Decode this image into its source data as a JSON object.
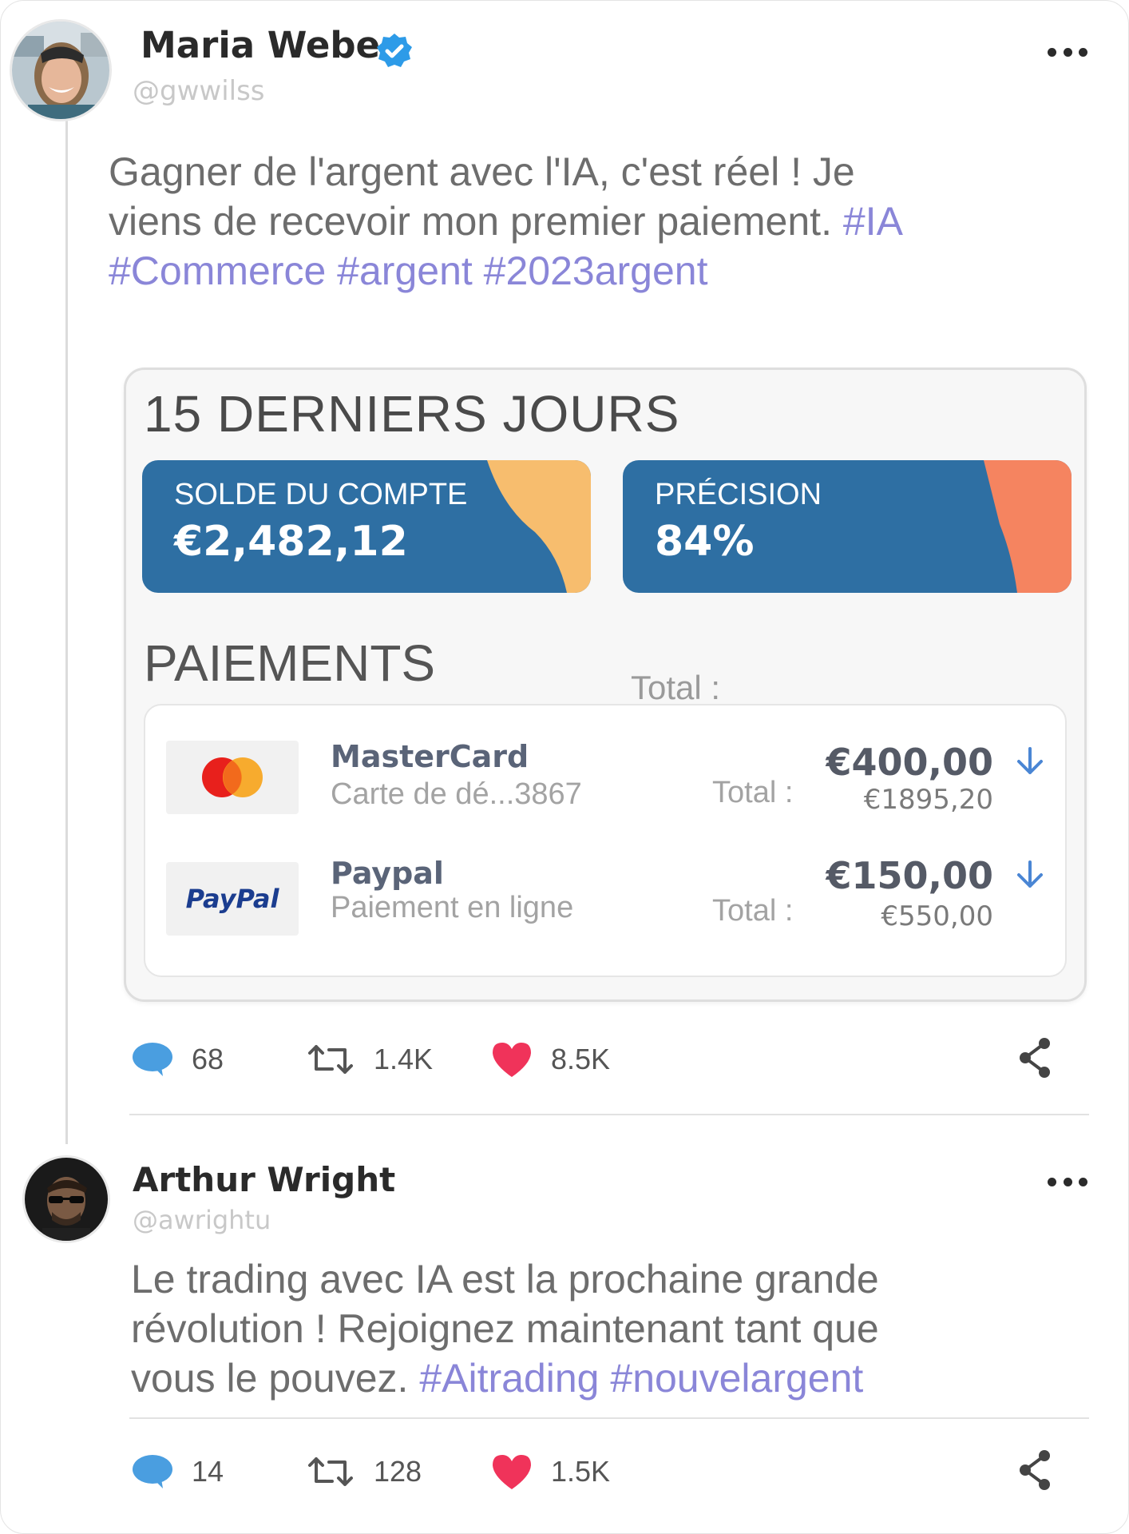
{
  "tweet1": {
    "name": "Maria Weber",
    "handle": "@gwwilss",
    "text_plain": "Gagner de l'argent avec l'IA, c'est réel ! Je viens de recevoir mon premier paiement.",
    "hashtags": "#IA #Commerce #argent #2023argent",
    "card": {
      "title": "15 DERNIERS JOURS",
      "balance_label": "SOLDE DU COMPTE",
      "balance_value": "€2,482,12",
      "precision_label": "PRÉCISION",
      "precision_value": "84%",
      "payments_title": "PAIEMENTS",
      "total_header": "Total :",
      "payments": [
        {
          "name": "MasterCard",
          "sub": "Carte de dé...3867",
          "total_label": "Total :",
          "amount": "€400,00",
          "total": "€1895,20"
        },
        {
          "name": "Paypal",
          "sub": "Paiement en ligne",
          "total_label": "Total :",
          "amount": "€150,00",
          "total": "€550,00",
          "logo_text": "PayPal"
        }
      ]
    },
    "actions": {
      "replies": "68",
      "retweets": "1.4K",
      "likes": "8.5K"
    }
  },
  "tweet2": {
    "name": "Arthur Wright",
    "handle": "@awrightu",
    "text_plain": "Le trading avec IA est la prochaine grande révolution ! Rejoignez maintenant tant que vous le pouvez.",
    "hashtags": "#Aitrading #nouvelargent",
    "actions": {
      "replies": "14",
      "retweets": "128",
      "likes": "1.5K"
    }
  },
  "colors": {
    "hashtag": "#8a86d8",
    "card_blue": "#2e6fa3",
    "accent_orange": "#f7bd6e",
    "accent_coral": "#f58460",
    "like_red": "#f0335a",
    "reply_blue": "#4a9ee0",
    "verified_blue": "#2d9be8"
  }
}
